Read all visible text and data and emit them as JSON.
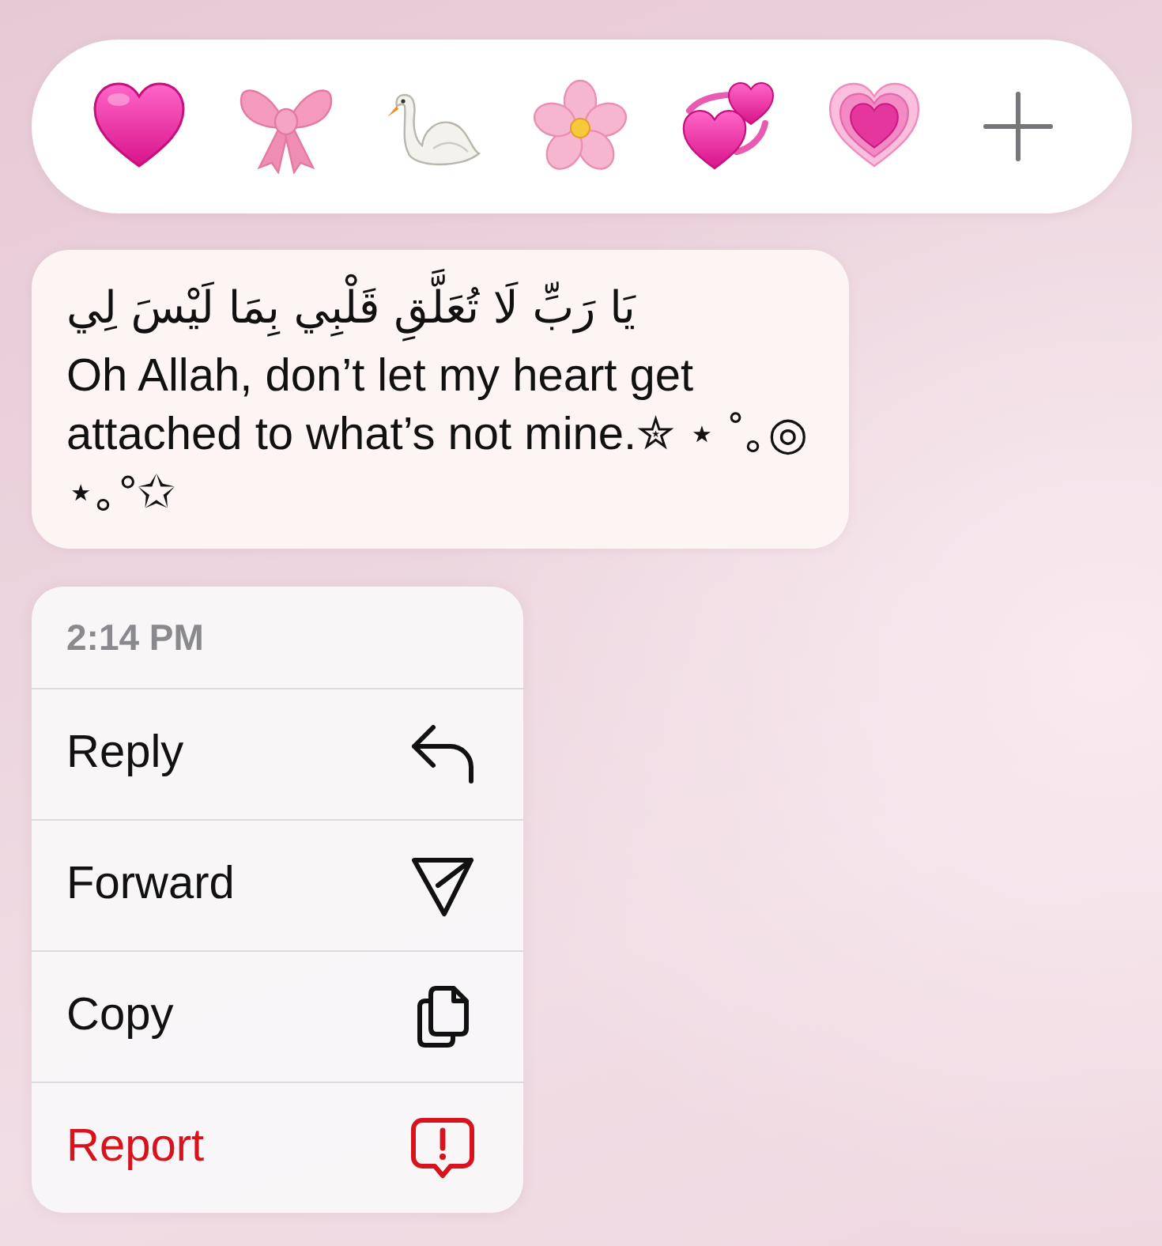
{
  "message": {
    "arabic_text": "يَا رَبِّ لَا تُعَلَّقِ قَلْبِي بِمَا لَيْسَ لِي",
    "text": "Oh Allah, don’t let my heart get attached to what’s not mine.✮ ⋆ ˚｡◎ ⋆｡°✩"
  },
  "context_menu": {
    "timestamp": "2:14 PM",
    "items": [
      {
        "label": "Reply",
        "kind": "reply",
        "destructive": false
      },
      {
        "label": "Forward",
        "kind": "forward",
        "destructive": false
      },
      {
        "label": "Copy",
        "kind": "copy",
        "destructive": false
      },
      {
        "label": "Report",
        "kind": "report",
        "destructive": true
      }
    ]
  }
}
